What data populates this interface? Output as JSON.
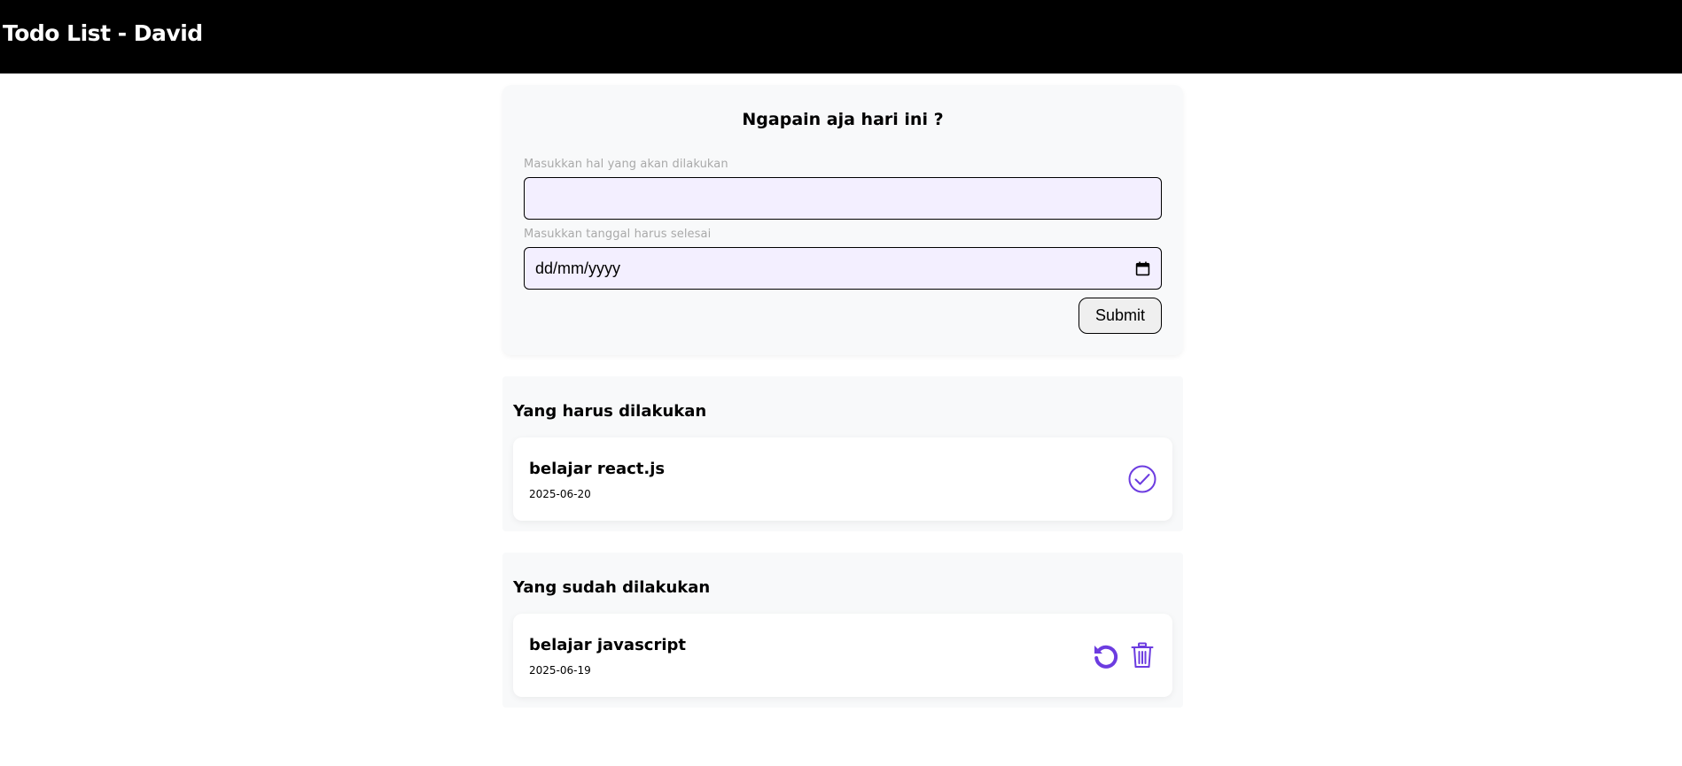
{
  "header": {
    "title": "Todo List - David"
  },
  "form": {
    "title": "Ngapain aja hari ini ?",
    "activity_label": "Masukkan hal yang akan dilakukan",
    "activity_value": "",
    "date_label": "Masukkan tanggal harus selesai",
    "date_value": "dd/mm/yyyy",
    "submit_label": "Submit"
  },
  "todo_section": {
    "title": "Yang harus dilakukan",
    "items": [
      {
        "title": "belajar react.js",
        "date": "2025-06-20",
        "action_icon": "check-circle-icon"
      }
    ]
  },
  "done_section": {
    "title": "Yang sudah dilakukan",
    "items": [
      {
        "title": "belajar javascript",
        "date": "2025-06-19",
        "action_icons": [
          "undo-icon",
          "trash-icon"
        ]
      }
    ]
  },
  "colors": {
    "header_bg": "#000000",
    "accent": "#6c3ce0",
    "input_bg": "#f3efff",
    "card_bg": "#f8f9fa"
  }
}
